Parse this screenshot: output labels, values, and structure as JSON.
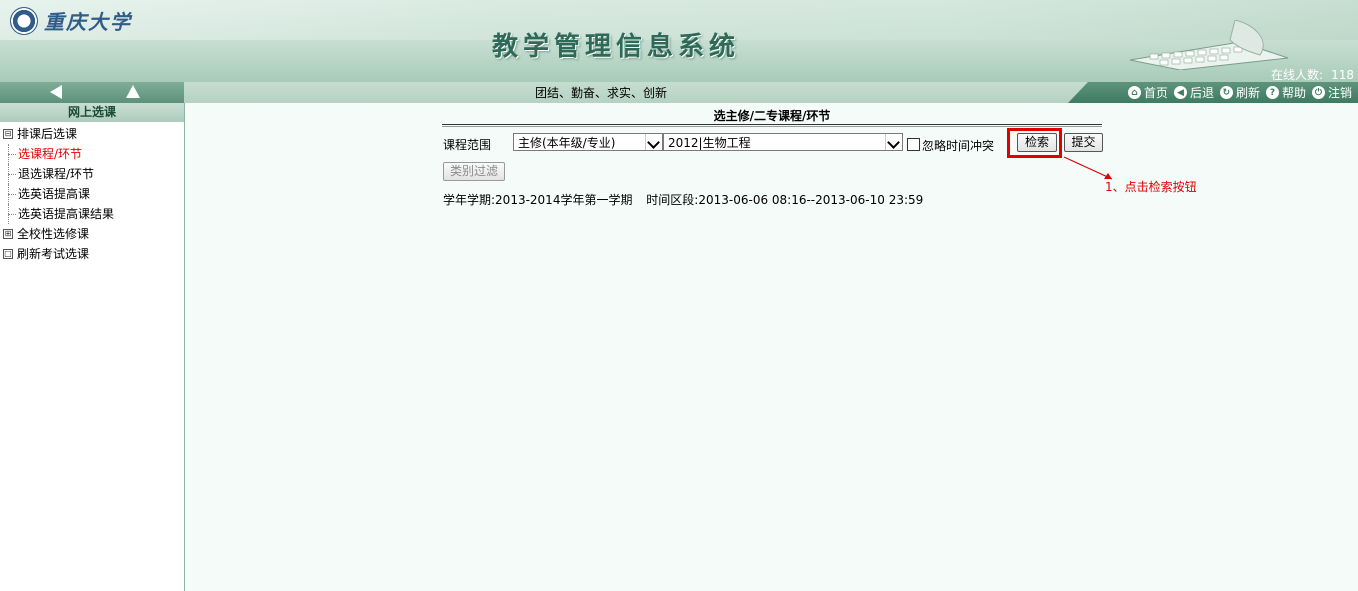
{
  "header": {
    "university_name": "重庆大学",
    "system_title": "教学管理信息系统",
    "online_label": "在线人数:",
    "online_count": "118"
  },
  "nav": {
    "slogan": "团结、勤奋、求实、创新",
    "links": [
      {
        "label": "首页",
        "icon": "home-icon"
      },
      {
        "label": "后退",
        "icon": "back-icon"
      },
      {
        "label": "刷新",
        "icon": "refresh-icon"
      },
      {
        "label": "帮助",
        "icon": "help-icon"
      },
      {
        "label": "注销",
        "icon": "logout-icon"
      }
    ]
  },
  "sidebar": {
    "title": "网上选课",
    "groups": [
      {
        "label": "排课后选课",
        "expander": "⊟"
      },
      {
        "label": "全校性选修课",
        "expander": "⊞"
      },
      {
        "label": "刷新考试选课",
        "expander": "□"
      }
    ],
    "items": [
      {
        "label": "选课程/环节",
        "active": true
      },
      {
        "label": "退选课程/环节"
      },
      {
        "label": "选英语提高课"
      },
      {
        "label": "选英语提高课结果"
      }
    ]
  },
  "main": {
    "title": "选主修/二专课程/环节",
    "range_label": "课程范围",
    "scope_select": "主修(本年级/专业)",
    "major_select": "2012|生物工程",
    "ignore_conflict_label": "忽略时间冲突",
    "search_button": "检索",
    "submit_button": "提交",
    "filter_button": "类别过滤",
    "term_label": "学年学期:",
    "term_value": "2013-2014学年第一学期",
    "period_label": "时间区段:",
    "period_value": "2013-06-06 08:16--2013-06-10 23:59"
  },
  "annotation": {
    "text": "1、点击检索按钮",
    "color": "#e00000"
  },
  "colors": {
    "header_green": "#2e6a57",
    "nav_green": "#3f7a62",
    "active_red": "#e00000"
  }
}
